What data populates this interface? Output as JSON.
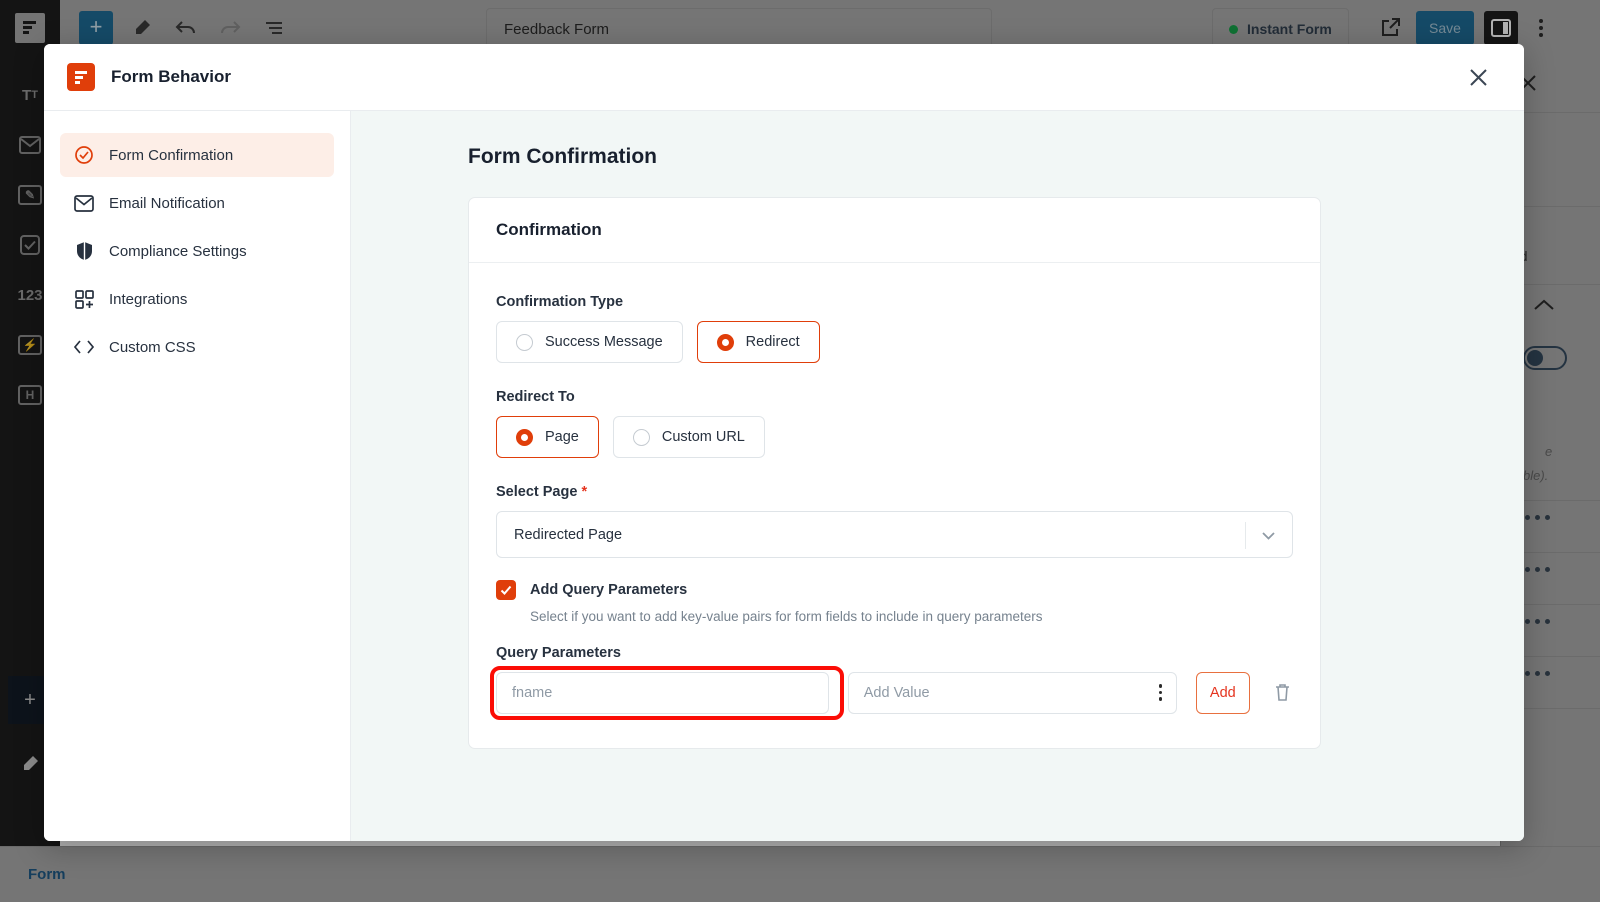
{
  "editor": {
    "form_title": "Feedback Form",
    "instant_form_label": "Instant Form",
    "save_label": "Save",
    "breadcrumb": "Form",
    "rail_items": [
      "Tt",
      "email-icon",
      "textarea-icon",
      "checkbox-icon",
      "123",
      "media-icon",
      "heading-icon"
    ],
    "right_panel": {
      "advanced_label": "ced",
      "note_line1": "e",
      "note_line2": "ble)."
    }
  },
  "modal": {
    "title": "Form Behavior",
    "logo_text": "F",
    "close_icon": "close-icon",
    "sidebar": {
      "items": [
        {
          "label": "Form Confirmation",
          "icon": "check-circle-icon",
          "active": true
        },
        {
          "label": "Email Notification",
          "icon": "envelope-icon",
          "active": false
        },
        {
          "label": "Compliance Settings",
          "icon": "shield-icon",
          "active": false
        },
        {
          "label": "Integrations",
          "icon": "grid-plus-icon",
          "active": false
        },
        {
          "label": "Custom CSS",
          "icon": "code-icon",
          "active": false
        }
      ]
    },
    "content": {
      "page_title": "Form Confirmation",
      "card_title": "Confirmation",
      "confirmation_type": {
        "label": "Confirmation Type",
        "options": [
          {
            "label": "Success Message",
            "selected": false
          },
          {
            "label": "Redirect",
            "selected": true
          }
        ]
      },
      "redirect_to": {
        "label": "Redirect To",
        "options": [
          {
            "label": "Page",
            "selected": true
          },
          {
            "label": "Custom URL",
            "selected": false
          }
        ]
      },
      "select_page": {
        "label": "Select Page",
        "required_marker": "*",
        "value": "Redirected Page"
      },
      "add_query_parameters": {
        "label": "Add Query Parameters",
        "checked": true,
        "help": "Select if you want to add key-value pairs for form fields to include in query parameters"
      },
      "query_parameters": {
        "label": "Query Parameters",
        "key_placeholder": "fname",
        "value_placeholder": "Add Value",
        "add_button": "Add",
        "delete_icon": "trash-icon",
        "highlight_color": "#fb0d06"
      }
    }
  },
  "colors": {
    "accent": "#e03e0a",
    "accent_text": "#e5341f",
    "active_bg": "#fdeee7",
    "content_bg": "#f2f7f6"
  }
}
